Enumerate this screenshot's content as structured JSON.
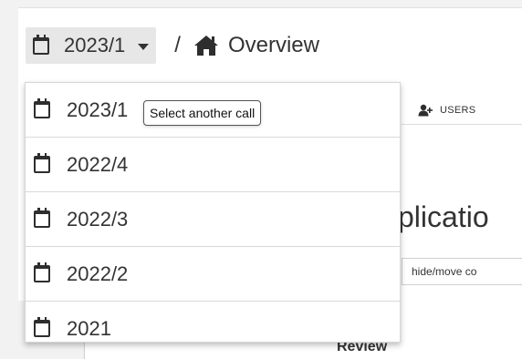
{
  "breadcrumb": {
    "selected_call": "2023/1",
    "separator": "/",
    "page_label": "Overview"
  },
  "tabs": {
    "users_label": "USERS"
  },
  "background": {
    "heading_fragment": "plicatio",
    "button_fragment": "hide/move co",
    "section_label": "Review"
  },
  "dropdown": {
    "items": [
      "2023/1",
      "2022/4",
      "2022/3",
      "2022/2",
      "2021"
    ],
    "tooltip": "Select another call"
  },
  "icons": {
    "calendar": "calendar-icon",
    "caret": "caret-down-icon",
    "home": "home-icon",
    "user_add": "user-plus-icon"
  }
}
